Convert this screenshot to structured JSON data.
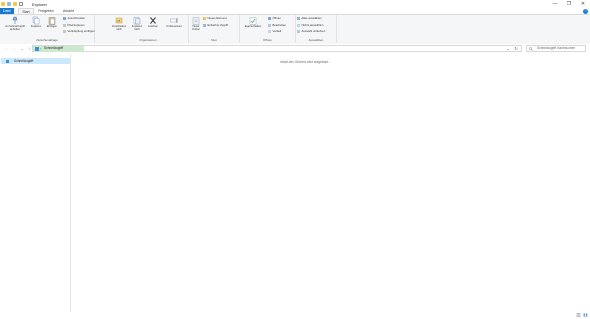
{
  "window": {
    "title": "Explorer",
    "controls": {
      "minimize": "—",
      "maximize": "❐",
      "close": "✕"
    }
  },
  "ribbon_tabs": [
    {
      "label": "Datei",
      "active": false
    },
    {
      "label": "Start",
      "active": true
    },
    {
      "label": "Freigeben",
      "active": false
    },
    {
      "label": "Ansicht",
      "active": false
    }
  ],
  "help": "?",
  "groups": {
    "clipboard": {
      "label": "Zwischenablage",
      "pin": "An Schnellzugriff\nanheften",
      "copy": "Kopieren",
      "paste": "Einfügen",
      "cut": "Ausschneiden",
      "copy_path": "Pfad kopieren",
      "paste_shortcut": "Verknüpfung einfügen"
    },
    "organize": {
      "label": "Organisieren",
      "move_to": "Verschieben\nnach",
      "copy_to": "Kopieren\nnach",
      "delete": "Löschen",
      "rename": "Umbenennen"
    },
    "new": {
      "label": "Neu",
      "new_folder": "Neuer\nOrdner",
      "new_item": "Neues Element",
      "easy_access": "Einfacher Zugriff"
    },
    "open": {
      "label": "Öffnen",
      "properties": "Eigenschaften",
      "open": "Öffnen",
      "edit": "Bearbeiten",
      "history": "Verlauf"
    },
    "select": {
      "label": "Auswählen",
      "select_all": "Alles auswählen",
      "select_none": "Nichts auswählen",
      "invert": "Auswahl umkehren"
    }
  },
  "address": {
    "location": "Schnellzugriff",
    "back": "←",
    "forward": "→",
    "up": "↑",
    "dropdown": "⌄",
    "refresh": "↻"
  },
  "search": {
    "placeholder": "Schnellzugriff durchsuchen"
  },
  "nav_pane": {
    "items": [
      {
        "label": "Schnellzugriff",
        "selected": true
      }
    ]
  },
  "content": {
    "empty_message": "Inhalt des Ordners wird aufgebaut..."
  },
  "colors": {
    "accent": "#1979ca",
    "selected_bg": "#cce8ff",
    "address_highlight": "#cce8cf"
  }
}
